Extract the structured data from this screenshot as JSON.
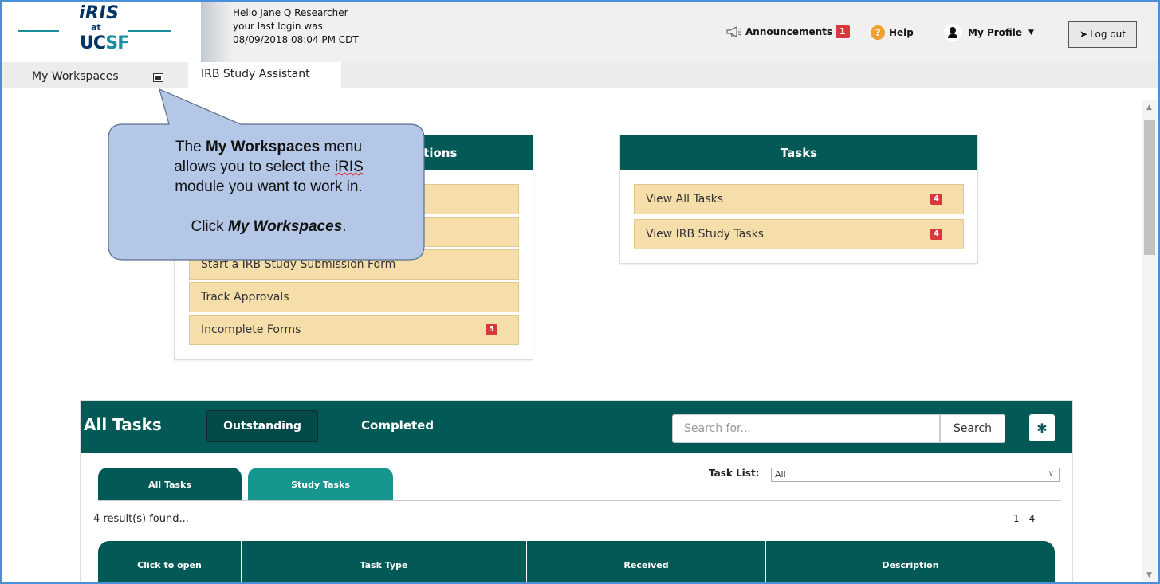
{
  "header": {
    "logo": {
      "iris": "iRIS",
      "at": "at",
      "uc": "UC",
      "sf": "SF"
    },
    "greeting_lines": [
      "Hello Jane Q Researcher",
      "your last login was",
      "08/09/2018 08:04 PM CDT"
    ],
    "announcements_label": "Announcements",
    "announcements_count": "1",
    "help_label": "Help",
    "profile_label": "My Profile",
    "logout_label": "Log out"
  },
  "nav": {
    "workspaces_label": "My Workspaces",
    "active_tab": "IRB Study Assistant"
  },
  "callout": {
    "line1_pre": "The ",
    "line1_bold": "My Workspaces",
    "line1_post": " menu",
    "line2_pre": "allows you to select the ",
    "line2_wavy": "iRIS",
    "line3": "module you want to work in.",
    "line4_pre": "Click ",
    "line4_bold": "My Workspaces",
    "line4_post": "."
  },
  "left_panel": {
    "title_visible": "rations",
    "items": [
      {
        "label": ""
      },
      {
        "label": ""
      },
      {
        "label": "Start a IRB Study Submission Form"
      },
      {
        "label": "Track Approvals"
      },
      {
        "label": "Incomplete Forms",
        "badge": "5"
      }
    ]
  },
  "tasks_panel": {
    "title": "Tasks",
    "items": [
      {
        "label": "View All Tasks",
        "badge": "4"
      },
      {
        "label": "View IRB Study Tasks",
        "badge": "4"
      }
    ]
  },
  "all_tasks": {
    "title": "All Tasks",
    "outstanding_label": "Outstanding",
    "completed_label": "Completed",
    "search_placeholder": "Search for...",
    "search_button": "Search",
    "tabs": [
      "All Tasks",
      "Study Tasks"
    ],
    "task_list_label": "Task List:",
    "task_list_value": "All",
    "results_text": "4 result(s) found...",
    "range_text": "1 - 4",
    "columns": [
      "Click to open",
      "Task Type",
      "Received",
      "Description"
    ]
  },
  "colors": {
    "teal_dark": "#035955",
    "teal_light": "#17968f",
    "item_bg": "#f5deaa",
    "badge_red": "#d9363e",
    "callout_fill": "#b4c7e7"
  }
}
